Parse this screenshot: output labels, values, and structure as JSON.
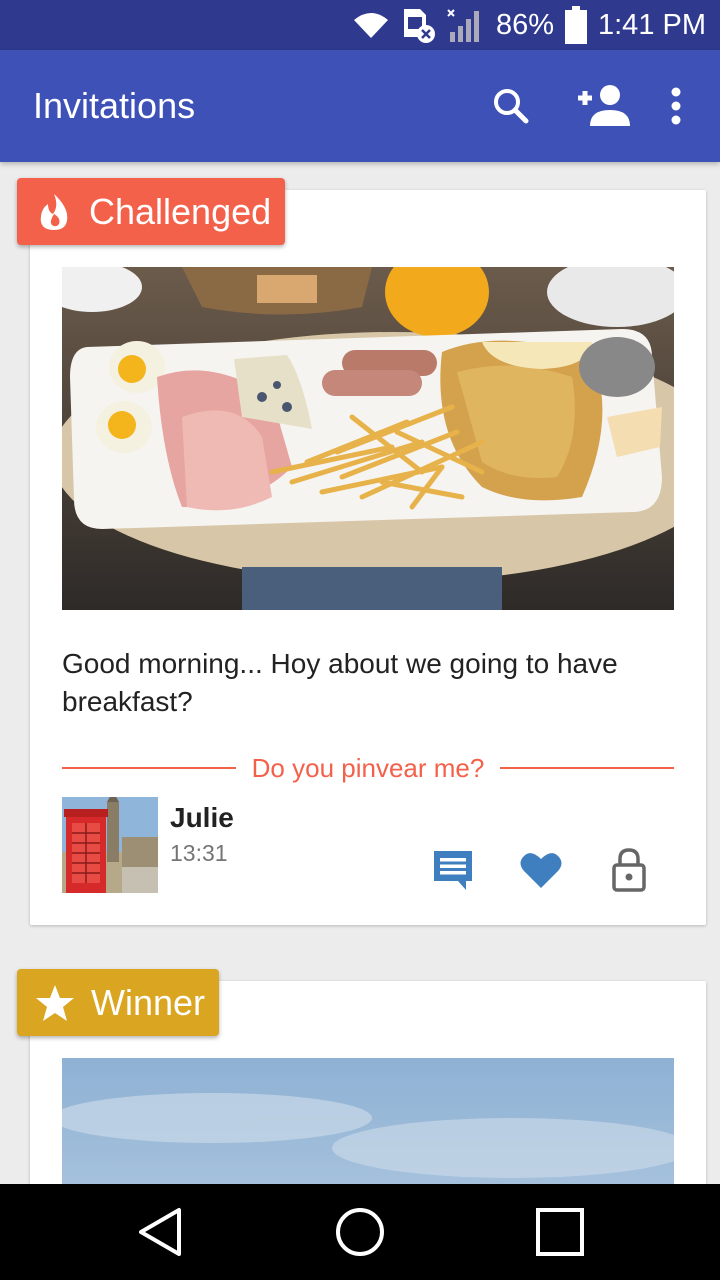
{
  "status_bar": {
    "battery": "86%",
    "time": "1:41 PM"
  },
  "app_bar": {
    "title": "Invitations"
  },
  "cards": [
    {
      "badge": "Challenged",
      "text": "Good morning...  Hoy about we going to have breakfast?",
      "prompt": "Do you pinvear me?",
      "author": {
        "name": "Julie",
        "time": "13:31"
      }
    },
    {
      "badge": "Winner"
    }
  ],
  "colors": {
    "accent": "#f4614a",
    "primary": "#3d51b7",
    "status": "#2f3a8f",
    "winner": "#daa520",
    "action_blue": "#3f7fbf"
  }
}
